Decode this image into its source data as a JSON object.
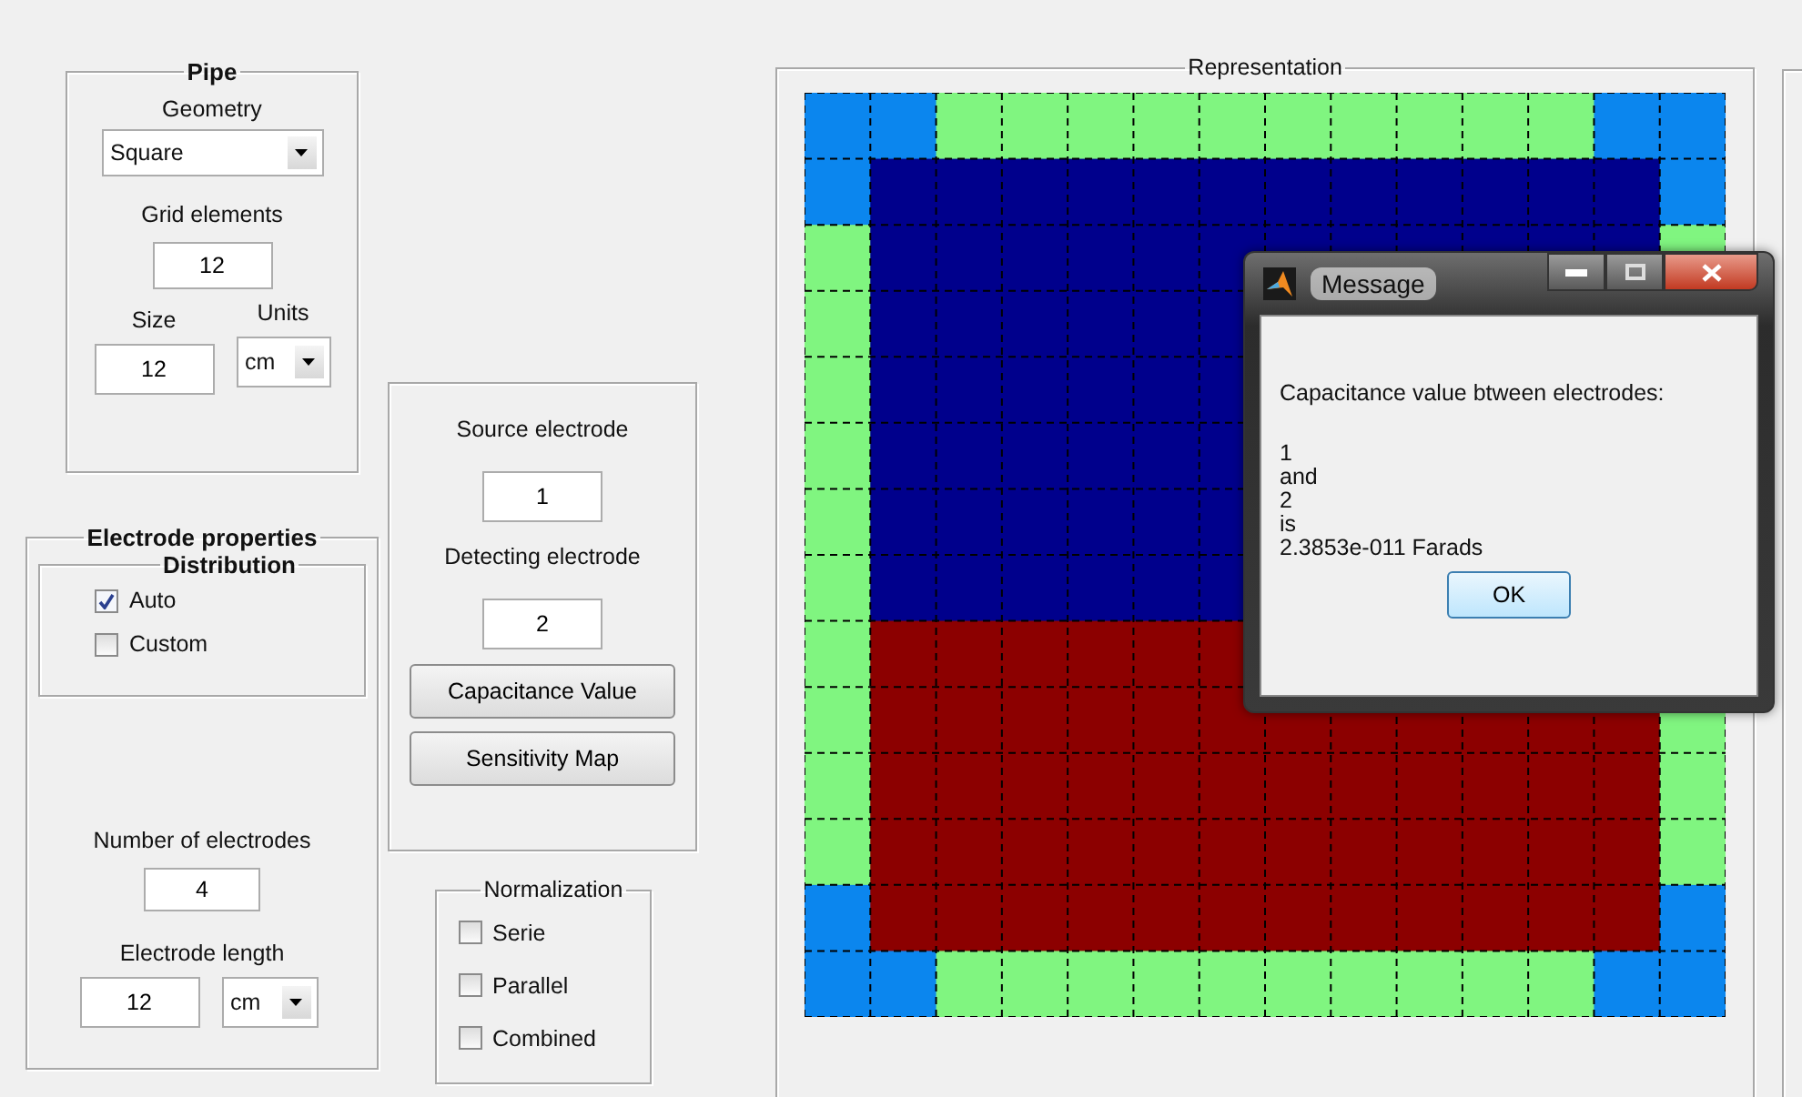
{
  "pipe": {
    "title": "Pipe",
    "geometry": {
      "label": "Geometry",
      "value": "Square"
    },
    "grid_elements": {
      "label": "Grid elements",
      "value": "12"
    },
    "size": {
      "label": "Size",
      "value": "12"
    },
    "units": {
      "label": "Units",
      "value": "cm"
    }
  },
  "electrode_properties": {
    "title": "Electrode properties",
    "distribution": {
      "title": "Distribution",
      "options": [
        {
          "label": "Auto",
          "checked": true
        },
        {
          "label": "Custom",
          "checked": false
        }
      ]
    },
    "number_of_electrodes": {
      "label": "Number of electrodes",
      "value": "4"
    },
    "electrode_length": {
      "label": "Electrode length",
      "value": "12",
      "units": "cm"
    }
  },
  "measurement": {
    "source": {
      "label": "Source electrode",
      "value": "1"
    },
    "detecting": {
      "label": "Detecting electrode",
      "value": "2"
    },
    "buttons": [
      "Capacitance Value",
      "Sensitivity Map"
    ]
  },
  "normalization": {
    "title": "Normalization",
    "options": [
      {
        "label": "Serie",
        "checked": false
      },
      {
        "label": "Parallel",
        "checked": false
      },
      {
        "label": "Combined",
        "checked": false
      }
    ]
  },
  "representation": {
    "title": "Representation"
  },
  "message_dialog": {
    "title": "Message",
    "lines": [
      "Capacitance value btween electrodes:",
      "1",
      "and",
      "2",
      "is",
      "2.3853e-011 Farads"
    ],
    "button": "OK"
  }
}
